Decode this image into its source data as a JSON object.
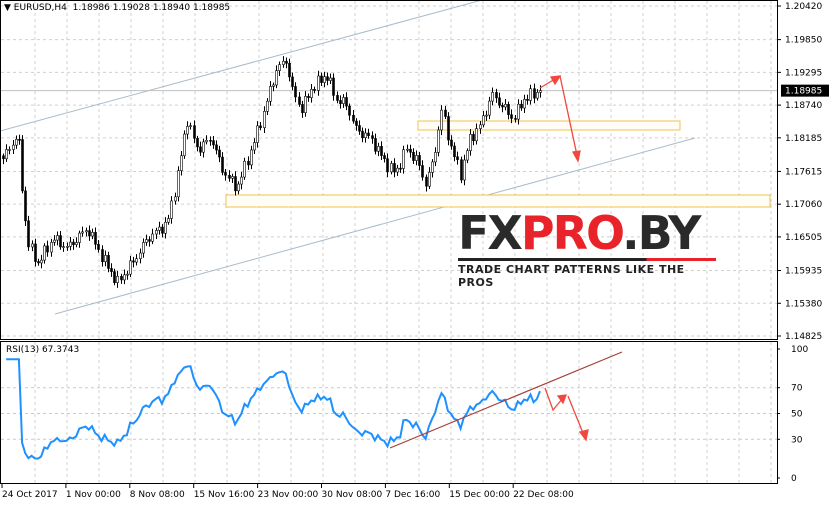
{
  "header": {
    "symbol_arrow": "▼",
    "symbol": "EURUSD,H4",
    "open": "1.18986",
    "high": "1.19028",
    "low": "1.18940",
    "close": "1.18985"
  },
  "rsi": {
    "label": "RSI(13) 67.3743",
    "value": 67.3743,
    "levels": [
      "100",
      "70",
      "50",
      "30",
      "0"
    ]
  },
  "logo": {
    "part1": "FX",
    "part2": "PRO",
    "part3": ".BY",
    "tagline": "TRADE CHART PATTERNS LIKE THE PROS"
  },
  "chart_data": {
    "type": "candlestick",
    "symbol": "EURUSD",
    "timeframe": "H4",
    "price_ticks": [
      "1.20420",
      "1.19850",
      "1.19295",
      "1.18740",
      "1.18185",
      "1.17615",
      "1.17060",
      "1.16505",
      "1.15935",
      "1.15380",
      "1.14825"
    ],
    "current_price": "1.18985",
    "ylim": [
      1.14825,
      1.2042
    ],
    "time_labels": [
      "24 Oct 2017",
      "1 Nov 00:00",
      "8 Nov 08:00",
      "15 Nov 16:00",
      "23 Nov 00:00",
      "30 Nov 08:00",
      "7 Dec 16:00",
      "15 Dec 00:00",
      "22 Dec 08:00"
    ],
    "close_path": [
      1.1783,
      1.1825,
      1.1716,
      1.164,
      1.1606,
      1.1648,
      1.1632,
      1.1665,
      1.1615,
      1.1573,
      1.1606,
      1.1648,
      1.1674,
      1.1749,
      1.185,
      1.18,
      1.1817,
      1.1766,
      1.1733,
      1.18,
      1.185,
      1.1934,
      1.1951,
      1.1901,
      1.1867,
      1.1901,
      1.1926,
      1.1884,
      1.1875,
      1.1833,
      1.1817,
      1.1775,
      1.1758,
      1.18,
      1.1783,
      1.1741,
      1.1775,
      1.1867,
      1.18,
      1.1758,
      1.1817,
      1.1842,
      1.1892,
      1.1867,
      1.185,
      1.1884,
      1.18985
    ],
    "path_positions": [
      0,
      0.028,
      0.037,
      0.046,
      0.065,
      0.093,
      0.12,
      0.157,
      0.185,
      0.213,
      0.241,
      0.269,
      0.306,
      0.324,
      0.343,
      0.361,
      0.389,
      0.407,
      0.435,
      0.463,
      0.481,
      0.509,
      0.528,
      0.537,
      0.556,
      0.574,
      0.602,
      0.62,
      0.639,
      0.657,
      0.685,
      0.713,
      0.731,
      0.75,
      0.769,
      0.787,
      0.8,
      0.817,
      0.835,
      0.852,
      0.87,
      0.89,
      0.91,
      0.935,
      0.95,
      0.97,
      1.0
    ],
    "bar_count": 170
  }
}
